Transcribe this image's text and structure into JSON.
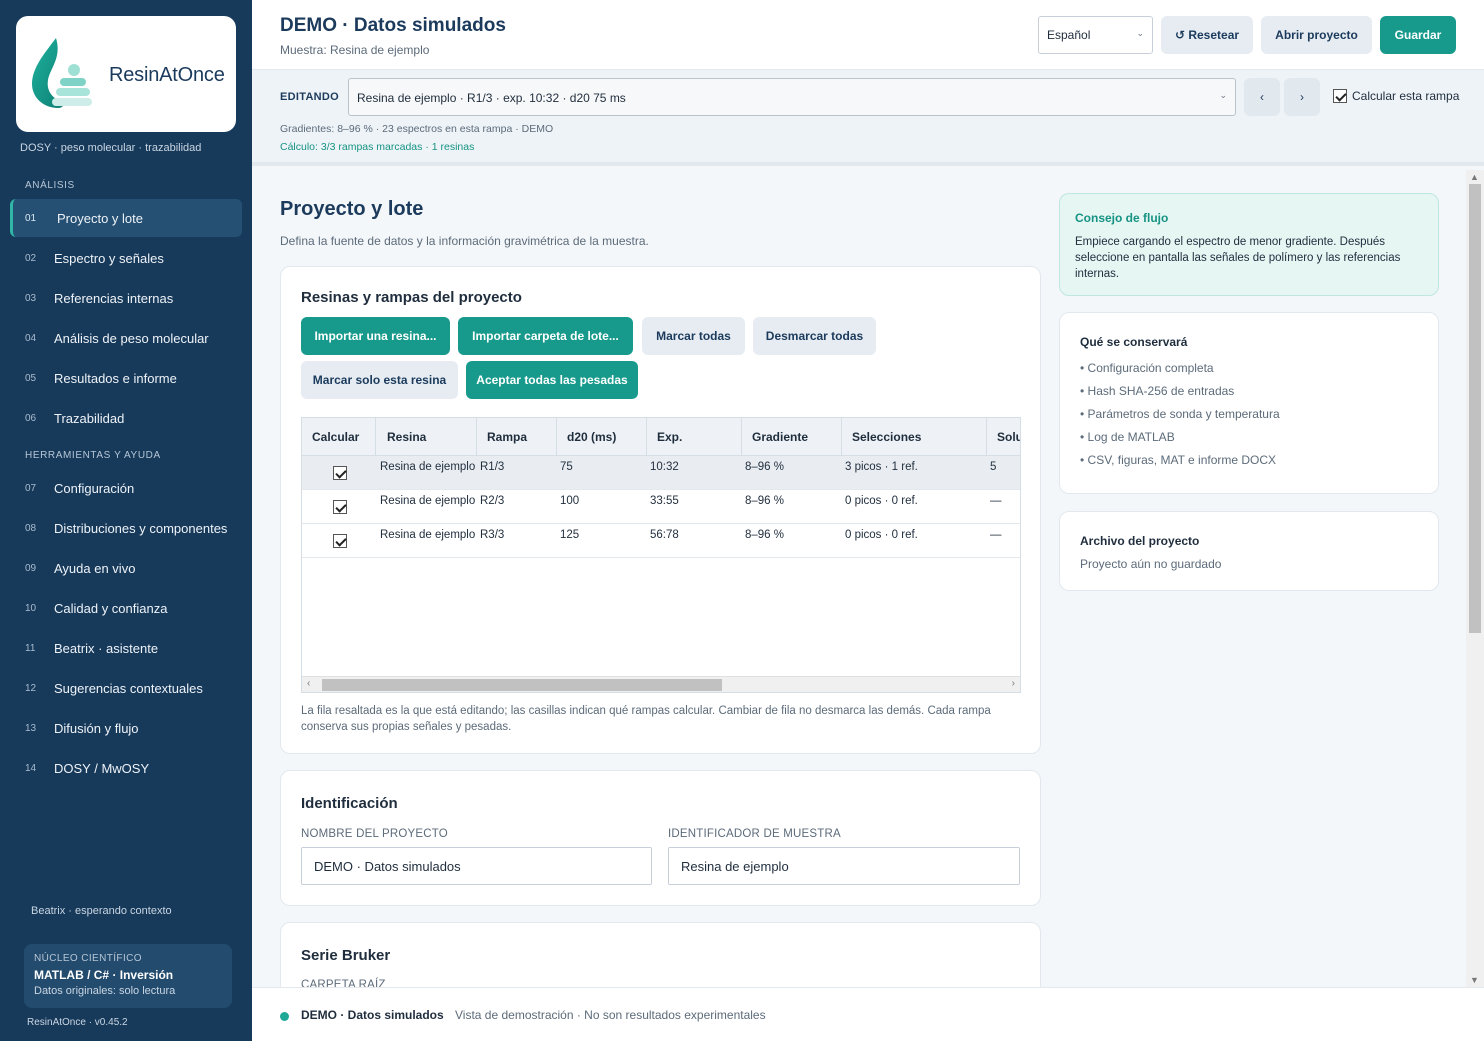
{
  "sidebar": {
    "logo_text": "ResinAtOnce",
    "tagline": "DOSY · peso molecular · trazabilidad",
    "section_analysis": "ANÁLISIS",
    "section_tools": "HERRAMIENTAS Y AYUDA",
    "items": [
      {
        "num": "01",
        "label": "Proyecto y lote"
      },
      {
        "num": "02",
        "label": "Espectro y señales"
      },
      {
        "num": "03",
        "label": "Referencias internas"
      },
      {
        "num": "04",
        "label": "Análisis de peso molecular"
      },
      {
        "num": "05",
        "label": "Resultados e informe"
      },
      {
        "num": "06",
        "label": "Trazabilidad"
      },
      {
        "num": "07",
        "label": "Configuración"
      },
      {
        "num": "08",
        "label": "Distribuciones y componentes"
      },
      {
        "num": "09",
        "label": "Ayuda en vivo"
      },
      {
        "num": "10",
        "label": "Calidad y confianza"
      },
      {
        "num": "11",
        "label": "Beatrix · asistente"
      },
      {
        "num": "12",
        "label": "Sugerencias contextuales"
      },
      {
        "num": "13",
        "label": "Difusión y flujo"
      },
      {
        "num": "14",
        "label": "DOSY / MwOSY"
      }
    ],
    "beatrix_status": "Beatrix · esperando contexto",
    "core_title": "NÚCLEO CIENTÍFICO",
    "core_main": "MATLAB / C# · Inversión",
    "core_sub": "Datos originales: solo lectura",
    "version": "ResinAtOnce · v0.45.2"
  },
  "header": {
    "title": "DEMO · Datos simulados",
    "subtitle": "Muestra: Resina de ejemplo",
    "language": "Español",
    "reset_label": "↺ Resetear",
    "open_label": "Abrir proyecto",
    "save_label": "Guardar"
  },
  "editbar": {
    "label": "EDITANDO",
    "selected": "Resina de ejemplo · R1/3 · exp. 10:32 · d20 75 ms",
    "prev": "‹",
    "next": "›",
    "calc_label": "Calcular esta rampa",
    "info": "Gradientes: 8–96 % · 23 espectros en esta rampa · DEMO",
    "calc_status": "Cálculo: 3/3 rampas marcadas · 1 resinas"
  },
  "main": {
    "title": "Proyecto y lote",
    "description": "Defina la fuente de datos y la información gravimétrica de la muestra.",
    "resins_card": {
      "title": "Resinas y rampas del proyecto",
      "btn_import_resin": "Importar una resina...",
      "btn_import_folder": "Importar carpeta de lote...",
      "btn_mark_all": "Marcar todas",
      "btn_unmark_all": "Desmarcar todas",
      "btn_mark_only": "Marcar solo esta resina",
      "btn_accept_weights": "Aceptar todas las pesadas",
      "columns": [
        "Calcular",
        "Resina",
        "Rampa",
        "d20 (ms)",
        "Exp.",
        "Gradiente",
        "Selecciones",
        "Solu"
      ],
      "rows": [
        {
          "resin": "Resina de ejemplo",
          "ramp": "R1/3",
          "d20": "75",
          "exp": "10:32",
          "gradient": "8–96 %",
          "selections": "3 picos · 1 ref.",
          "solu": "5"
        },
        {
          "resin": "Resina de ejemplo",
          "ramp": "R2/3",
          "d20": "100",
          "exp": "33:55",
          "gradient": "8–96 %",
          "selections": "0 picos · 0 ref.",
          "solu": "—"
        },
        {
          "resin": "Resina de ejemplo",
          "ramp": "R3/3",
          "d20": "125",
          "exp": "56:78",
          "gradient": "8–96 %",
          "selections": "0 picos · 0 ref.",
          "solu": "—"
        }
      ],
      "note": "La fila resaltada es la que está editando; las casillas indican qué rampas calcular. Cambiar de fila no desmarca las demás. Cada rampa conserva sus propias señales y pesadas."
    },
    "identification": {
      "title": "Identificación",
      "project_label": "NOMBRE DEL PROYECTO",
      "project_value": "DEMO · Datos simulados",
      "sample_label": "IDENTIFICADOR DE MUESTRA",
      "sample_value": "Resina de ejemplo"
    },
    "bruker": {
      "title": "Serie Bruker",
      "root_label": "CARPETA RAÍZ"
    }
  },
  "aside": {
    "tip_title": "Consejo de flujo",
    "tip_text": "Empiece cargando el espectro de menor gradiente. Después seleccione en pantalla las señales de polímero y las referencias internas.",
    "keep_title": "Qué se conservará",
    "keep_items": [
      "• Configuración completa",
      "• Hash SHA-256 de entradas",
      "• Parámetros de sonda y temperatura",
      "• Log de MATLAB",
      "• CSV, figuras, MAT e informe DOCX"
    ],
    "archive_title": "Archivo del proyecto",
    "archive_status": "Proyecto aún no guardado"
  },
  "footer": {
    "title": "DEMO · Datos simulados",
    "subtitle": "Vista de demostración · No son resultados experimentales"
  },
  "colors": {
    "sidebar": "#17395a",
    "accent": "#179a8c",
    "navy": "#1b3a5c"
  }
}
